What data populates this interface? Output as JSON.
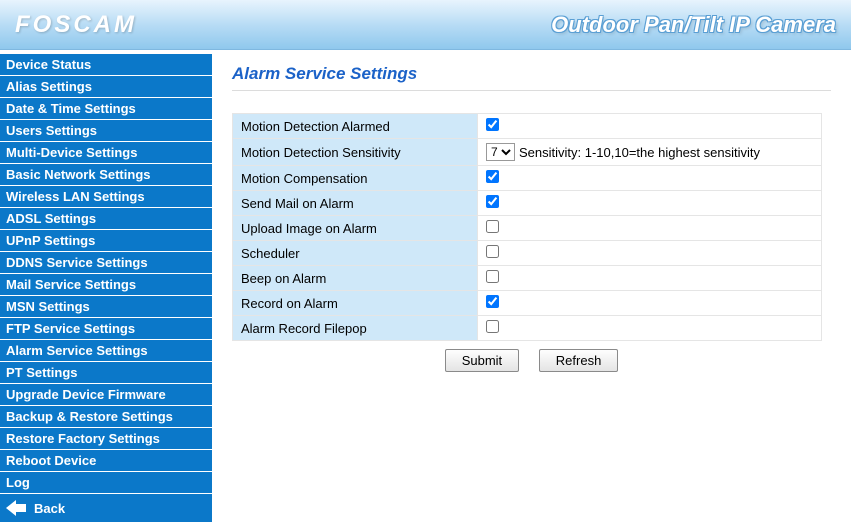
{
  "header": {
    "logo": "FOSCAM",
    "title": "Outdoor Pan/Tilt IP Camera"
  },
  "sidebar": {
    "items": [
      "Device Status",
      "Alias Settings",
      "Date & Time Settings",
      "Users Settings",
      "Multi-Device Settings",
      "Basic Network Settings",
      "Wireless LAN Settings",
      "ADSL Settings",
      "UPnP Settings",
      "DDNS Service Settings",
      "Mail Service Settings",
      "MSN Settings",
      "FTP Service Settings",
      "Alarm Service Settings",
      "PT Settings",
      "Upgrade Device Firmware",
      "Backup & Restore Settings",
      "Restore Factory Settings",
      "Reboot Device",
      "Log"
    ],
    "back_label": "Back"
  },
  "page": {
    "title": "Alarm Service Settings",
    "rows": {
      "motion_alarmed": {
        "label": "Motion Detection Alarmed",
        "checked": true
      },
      "motion_sensitivity": {
        "label": "Motion Detection Sensitivity",
        "value": "7",
        "hint": "Sensitivity: 1-10,10=the highest sensitivity"
      },
      "motion_compensation": {
        "label": "Motion Compensation",
        "checked": true
      },
      "send_mail": {
        "label": "Send Mail on Alarm",
        "checked": true
      },
      "upload_image": {
        "label": "Upload Image on Alarm",
        "checked": false
      },
      "scheduler": {
        "label": "Scheduler",
        "checked": false
      },
      "beep": {
        "label": "Beep on Alarm",
        "checked": false
      },
      "record": {
        "label": "Record on Alarm",
        "checked": true
      },
      "filepop": {
        "label": "Alarm Record Filepop",
        "checked": false
      }
    },
    "buttons": {
      "submit": "Submit",
      "refresh": "Refresh"
    }
  }
}
